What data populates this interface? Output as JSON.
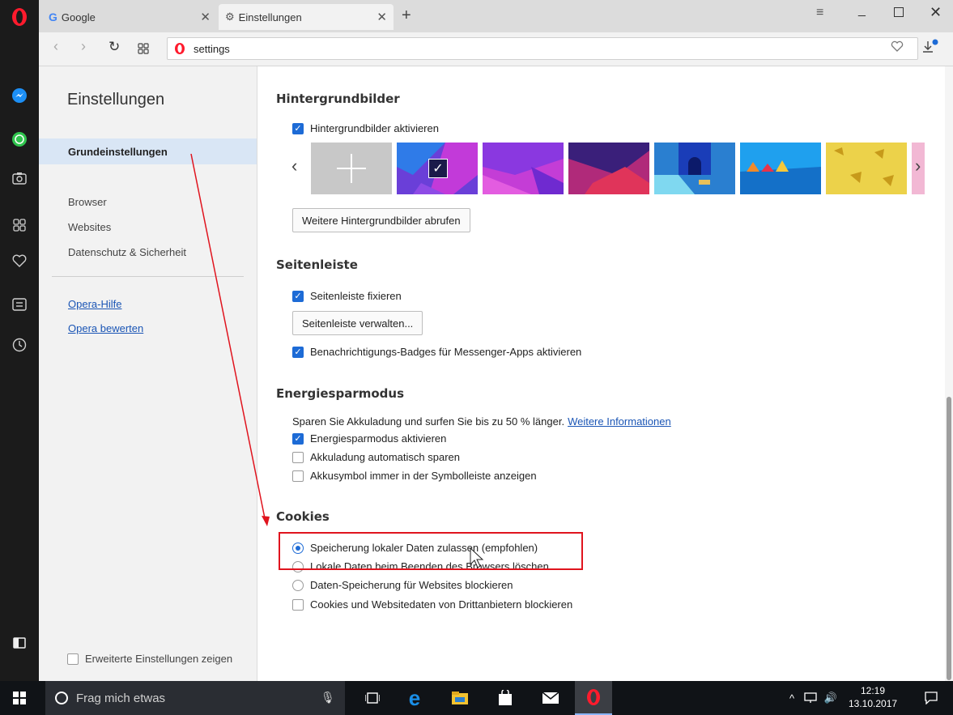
{
  "tabs": [
    {
      "title": "Google",
      "icon": "google-g-icon",
      "color": "#4285f4"
    },
    {
      "title": "Einstellungen",
      "icon": "gear-icon"
    }
  ],
  "address": {
    "url": "settings"
  },
  "sidebar_icons": [
    "messenger-icon",
    "whatsapp-icon",
    "camera-icon",
    "speed-dial-icon",
    "heart-icon",
    "news-icon",
    "history-icon",
    "sidebar-toggle-icon"
  ],
  "settings_nav": {
    "title": "Einstellungen",
    "active": "Grundeinstellungen",
    "items": [
      "Browser",
      "Websites",
      "Datenschutz & Sicherheit"
    ],
    "links": [
      "Opera-Hilfe",
      "Opera bewerten"
    ],
    "advanced_label": "Erweiterte Einstellungen zeigen"
  },
  "wallpapers": {
    "heading": "Hintergrundbilder",
    "enable_label": "Hintergrundbilder aktivieren",
    "more_button": "Weitere Hintergrundbilder abrufen",
    "colors": [
      "#c8c8c8",
      "#6a3fd8",
      "#c43dd6",
      "#3a1f7a",
      "#2a7fd0",
      "#1fa0ee",
      "#ecd24a",
      "#f2b8d4"
    ]
  },
  "sidebar_section": {
    "heading": "Seitenleiste",
    "pin_label": "Seitenleiste fixieren",
    "manage_button": "Seitenleiste verwalten...",
    "badges_label": "Benachrichtigungs-Badges für Messenger-Apps aktivieren"
  },
  "battery": {
    "heading": "Energiesparmodus",
    "description": "Sparen Sie Akkuladung und surfen Sie bis zu 50 % länger.",
    "more_info": "Weitere Informationen",
    "options": [
      {
        "label": "Energiesparmodus aktivieren",
        "checked": true
      },
      {
        "label": "Akkuladung automatisch sparen",
        "checked": false
      },
      {
        "label": "Akkusymbol immer in der Symbolleiste anzeigen",
        "checked": false
      }
    ]
  },
  "cookies": {
    "heading": "Cookies",
    "radios": [
      {
        "label": "Speicherung lokaler Daten zulassen (empfohlen)",
        "selected": true
      },
      {
        "label": "Lokale Daten beim Beenden des Browsers löschen",
        "selected": false
      },
      {
        "label": "Daten-Speicherung für Websites blockieren",
        "selected": false
      }
    ],
    "third_party_label": "Cookies und Websitedaten von Drittanbietern blockieren"
  },
  "annotation_color": "#e0141e",
  "taskbar": {
    "search_placeholder": "Frag mich etwas",
    "time": "12:19",
    "date": "13.10.2017"
  }
}
